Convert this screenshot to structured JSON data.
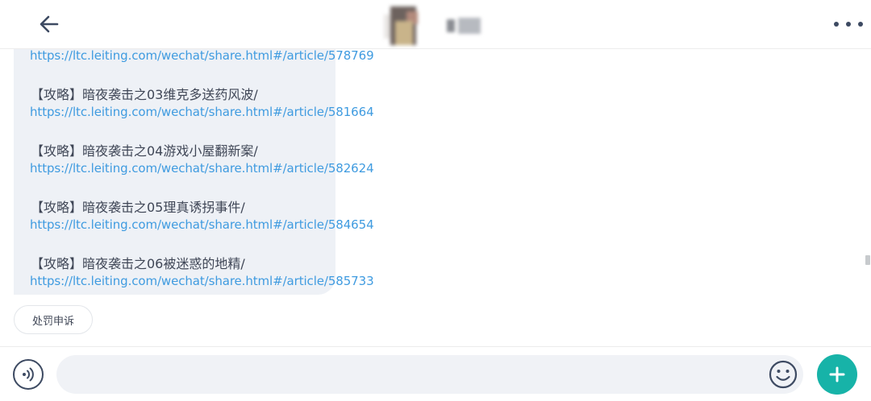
{
  "header": {
    "back_icon": "arrow-left-icon",
    "more_icon": "more-horizontal-icon"
  },
  "messages": {
    "top_link": "https://ltc.leiting.com/wechat/share.html#/article/578769",
    "guides": [
      {
        "title": "【攻略】暗夜袭击之03维克多送药风波/",
        "link": "https://ltc.leiting.com/wechat/share.html#/article/581664"
      },
      {
        "title": "【攻略】暗夜袭击之04游戏小屋翻新案/",
        "link": "https://ltc.leiting.com/wechat/share.html#/article/582624"
      },
      {
        "title": "【攻略】暗夜袭击之05理真诱拐事件/",
        "link": "https://ltc.leiting.com/wechat/share.html#/article/584654"
      },
      {
        "title": "【攻略】暗夜袭击之06被迷惑的地精/",
        "link": "https://ltc.leiting.com/wechat/share.html#/article/585733"
      }
    ],
    "quick_reply": "处罚申诉"
  },
  "input_bar": {
    "voice_icon": "voice-icon",
    "emoji_icon": "smiley-icon",
    "plus_icon": "plus-icon",
    "message_placeholder": ""
  },
  "colors": {
    "link": "#3f9be0",
    "text": "#3f4656",
    "bubble": "#eef1f6",
    "accent": "#17b3a8",
    "icon": "#3d4a62"
  }
}
